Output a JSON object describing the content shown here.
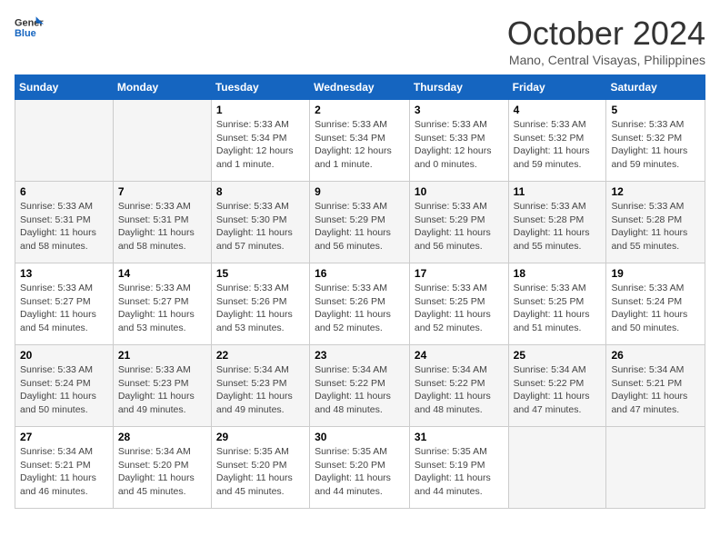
{
  "header": {
    "logo_line1": "General",
    "logo_line2": "Blue",
    "month": "October 2024",
    "location": "Mano, Central Visayas, Philippines"
  },
  "days_of_week": [
    "Sunday",
    "Monday",
    "Tuesday",
    "Wednesday",
    "Thursday",
    "Friday",
    "Saturday"
  ],
  "weeks": [
    [
      {
        "num": "",
        "sunrise": "",
        "sunset": "",
        "daylight": ""
      },
      {
        "num": "",
        "sunrise": "",
        "sunset": "",
        "daylight": ""
      },
      {
        "num": "1",
        "sunrise": "Sunrise: 5:33 AM",
        "sunset": "Sunset: 5:34 PM",
        "daylight": "Daylight: 12 hours and 1 minute."
      },
      {
        "num": "2",
        "sunrise": "Sunrise: 5:33 AM",
        "sunset": "Sunset: 5:34 PM",
        "daylight": "Daylight: 12 hours and 1 minute."
      },
      {
        "num": "3",
        "sunrise": "Sunrise: 5:33 AM",
        "sunset": "Sunset: 5:33 PM",
        "daylight": "Daylight: 12 hours and 0 minutes."
      },
      {
        "num": "4",
        "sunrise": "Sunrise: 5:33 AM",
        "sunset": "Sunset: 5:32 PM",
        "daylight": "Daylight: 11 hours and 59 minutes."
      },
      {
        "num": "5",
        "sunrise": "Sunrise: 5:33 AM",
        "sunset": "Sunset: 5:32 PM",
        "daylight": "Daylight: 11 hours and 59 minutes."
      }
    ],
    [
      {
        "num": "6",
        "sunrise": "Sunrise: 5:33 AM",
        "sunset": "Sunset: 5:31 PM",
        "daylight": "Daylight: 11 hours and 58 minutes."
      },
      {
        "num": "7",
        "sunrise": "Sunrise: 5:33 AM",
        "sunset": "Sunset: 5:31 PM",
        "daylight": "Daylight: 11 hours and 58 minutes."
      },
      {
        "num": "8",
        "sunrise": "Sunrise: 5:33 AM",
        "sunset": "Sunset: 5:30 PM",
        "daylight": "Daylight: 11 hours and 57 minutes."
      },
      {
        "num": "9",
        "sunrise": "Sunrise: 5:33 AM",
        "sunset": "Sunset: 5:29 PM",
        "daylight": "Daylight: 11 hours and 56 minutes."
      },
      {
        "num": "10",
        "sunrise": "Sunrise: 5:33 AM",
        "sunset": "Sunset: 5:29 PM",
        "daylight": "Daylight: 11 hours and 56 minutes."
      },
      {
        "num": "11",
        "sunrise": "Sunrise: 5:33 AM",
        "sunset": "Sunset: 5:28 PM",
        "daylight": "Daylight: 11 hours and 55 minutes."
      },
      {
        "num": "12",
        "sunrise": "Sunrise: 5:33 AM",
        "sunset": "Sunset: 5:28 PM",
        "daylight": "Daylight: 11 hours and 55 minutes."
      }
    ],
    [
      {
        "num": "13",
        "sunrise": "Sunrise: 5:33 AM",
        "sunset": "Sunset: 5:27 PM",
        "daylight": "Daylight: 11 hours and 54 minutes."
      },
      {
        "num": "14",
        "sunrise": "Sunrise: 5:33 AM",
        "sunset": "Sunset: 5:27 PM",
        "daylight": "Daylight: 11 hours and 53 minutes."
      },
      {
        "num": "15",
        "sunrise": "Sunrise: 5:33 AM",
        "sunset": "Sunset: 5:26 PM",
        "daylight": "Daylight: 11 hours and 53 minutes."
      },
      {
        "num": "16",
        "sunrise": "Sunrise: 5:33 AM",
        "sunset": "Sunset: 5:26 PM",
        "daylight": "Daylight: 11 hours and 52 minutes."
      },
      {
        "num": "17",
        "sunrise": "Sunrise: 5:33 AM",
        "sunset": "Sunset: 5:25 PM",
        "daylight": "Daylight: 11 hours and 52 minutes."
      },
      {
        "num": "18",
        "sunrise": "Sunrise: 5:33 AM",
        "sunset": "Sunset: 5:25 PM",
        "daylight": "Daylight: 11 hours and 51 minutes."
      },
      {
        "num": "19",
        "sunrise": "Sunrise: 5:33 AM",
        "sunset": "Sunset: 5:24 PM",
        "daylight": "Daylight: 11 hours and 50 minutes."
      }
    ],
    [
      {
        "num": "20",
        "sunrise": "Sunrise: 5:33 AM",
        "sunset": "Sunset: 5:24 PM",
        "daylight": "Daylight: 11 hours and 50 minutes."
      },
      {
        "num": "21",
        "sunrise": "Sunrise: 5:33 AM",
        "sunset": "Sunset: 5:23 PM",
        "daylight": "Daylight: 11 hours and 49 minutes."
      },
      {
        "num": "22",
        "sunrise": "Sunrise: 5:34 AM",
        "sunset": "Sunset: 5:23 PM",
        "daylight": "Daylight: 11 hours and 49 minutes."
      },
      {
        "num": "23",
        "sunrise": "Sunrise: 5:34 AM",
        "sunset": "Sunset: 5:22 PM",
        "daylight": "Daylight: 11 hours and 48 minutes."
      },
      {
        "num": "24",
        "sunrise": "Sunrise: 5:34 AM",
        "sunset": "Sunset: 5:22 PM",
        "daylight": "Daylight: 11 hours and 48 minutes."
      },
      {
        "num": "25",
        "sunrise": "Sunrise: 5:34 AM",
        "sunset": "Sunset: 5:22 PM",
        "daylight": "Daylight: 11 hours and 47 minutes."
      },
      {
        "num": "26",
        "sunrise": "Sunrise: 5:34 AM",
        "sunset": "Sunset: 5:21 PM",
        "daylight": "Daylight: 11 hours and 47 minutes."
      }
    ],
    [
      {
        "num": "27",
        "sunrise": "Sunrise: 5:34 AM",
        "sunset": "Sunset: 5:21 PM",
        "daylight": "Daylight: 11 hours and 46 minutes."
      },
      {
        "num": "28",
        "sunrise": "Sunrise: 5:34 AM",
        "sunset": "Sunset: 5:20 PM",
        "daylight": "Daylight: 11 hours and 45 minutes."
      },
      {
        "num": "29",
        "sunrise": "Sunrise: 5:35 AM",
        "sunset": "Sunset: 5:20 PM",
        "daylight": "Daylight: 11 hours and 45 minutes."
      },
      {
        "num": "30",
        "sunrise": "Sunrise: 5:35 AM",
        "sunset": "Sunset: 5:20 PM",
        "daylight": "Daylight: 11 hours and 44 minutes."
      },
      {
        "num": "31",
        "sunrise": "Sunrise: 5:35 AM",
        "sunset": "Sunset: 5:19 PM",
        "daylight": "Daylight: 11 hours and 44 minutes."
      },
      {
        "num": "",
        "sunrise": "",
        "sunset": "",
        "daylight": ""
      },
      {
        "num": "",
        "sunrise": "",
        "sunset": "",
        "daylight": ""
      }
    ]
  ]
}
